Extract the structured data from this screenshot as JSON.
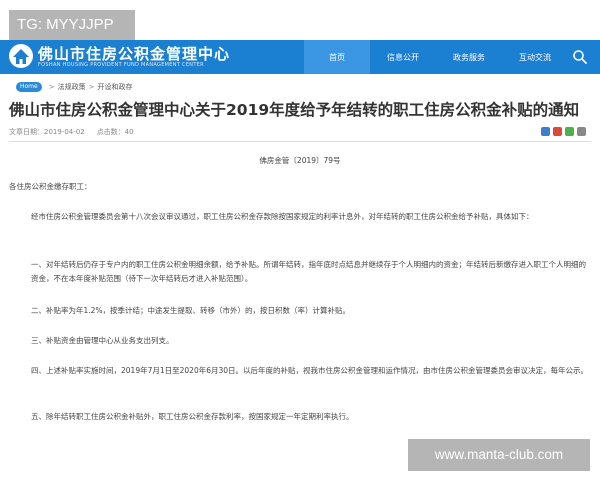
{
  "watermark_top": "TG: MYYJJPP",
  "watermark_bottom": "www.manta-club.com",
  "site": {
    "title": "佛山市住房公积金管理中心",
    "subtitle": "FOSHAN HOUSING PROVIDENT FUND MANAGEMENT CENTER"
  },
  "nav": {
    "items": [
      {
        "label": "首页"
      },
      {
        "label": "信息公开"
      },
      {
        "label": "政务服务"
      },
      {
        "label": "互动交流"
      }
    ]
  },
  "breadcrumb": {
    "home": "Home",
    "items": [
      "法规政策",
      "开设和政存"
    ]
  },
  "article": {
    "title": "佛山市住房公积金管理中心关于2019年度给予年结转的职工住房公积金补贴的通知",
    "date": "文章日期：2019-04-02",
    "views": "点击数：40",
    "doc_no": "佛房金管〔2019〕79号",
    "salutation": "各住房公积金缴存职工：",
    "p1": "经市住房公积金管理委员会第十八次会议审议通过，职工住房公积金存款除按国家规定的利率计息外，对年结转的职工住房公积金给予补贴，具体如下：",
    "p2": "一、对年结转后仍存于专户内的职工住房公积金明细余额，给予补贴。所谓年结转，指年底时点结息并继续存于个人明细内的资金；年结转后新缴存进入职工个人明细的资金，不在本年度补贴范围（待下一次年结转后才进入补贴范围）。",
    "p3": "二、补贴率为年1.2%，按季计结；中途发生提取、转移（市外）的，按日积数（率）计算补贴。",
    "p4": "三、补贴资金由管理中心从业务支出列支。",
    "p5": "四、上述补贴率实施时间，2019年7月1日至2020年6月30日。以后年度的补贴，视我市住房公积金管理和运作情况，由市住房公积金管理委员会审议决定，每年公示。",
    "p6": "五、除年结转职工住房公积金补贴外，职工住房公积金存款利率，按国家规定一年定期利率执行。"
  },
  "colors": {
    "header_bg": "#1b7fd2",
    "nav_active": "#3b97e3"
  }
}
